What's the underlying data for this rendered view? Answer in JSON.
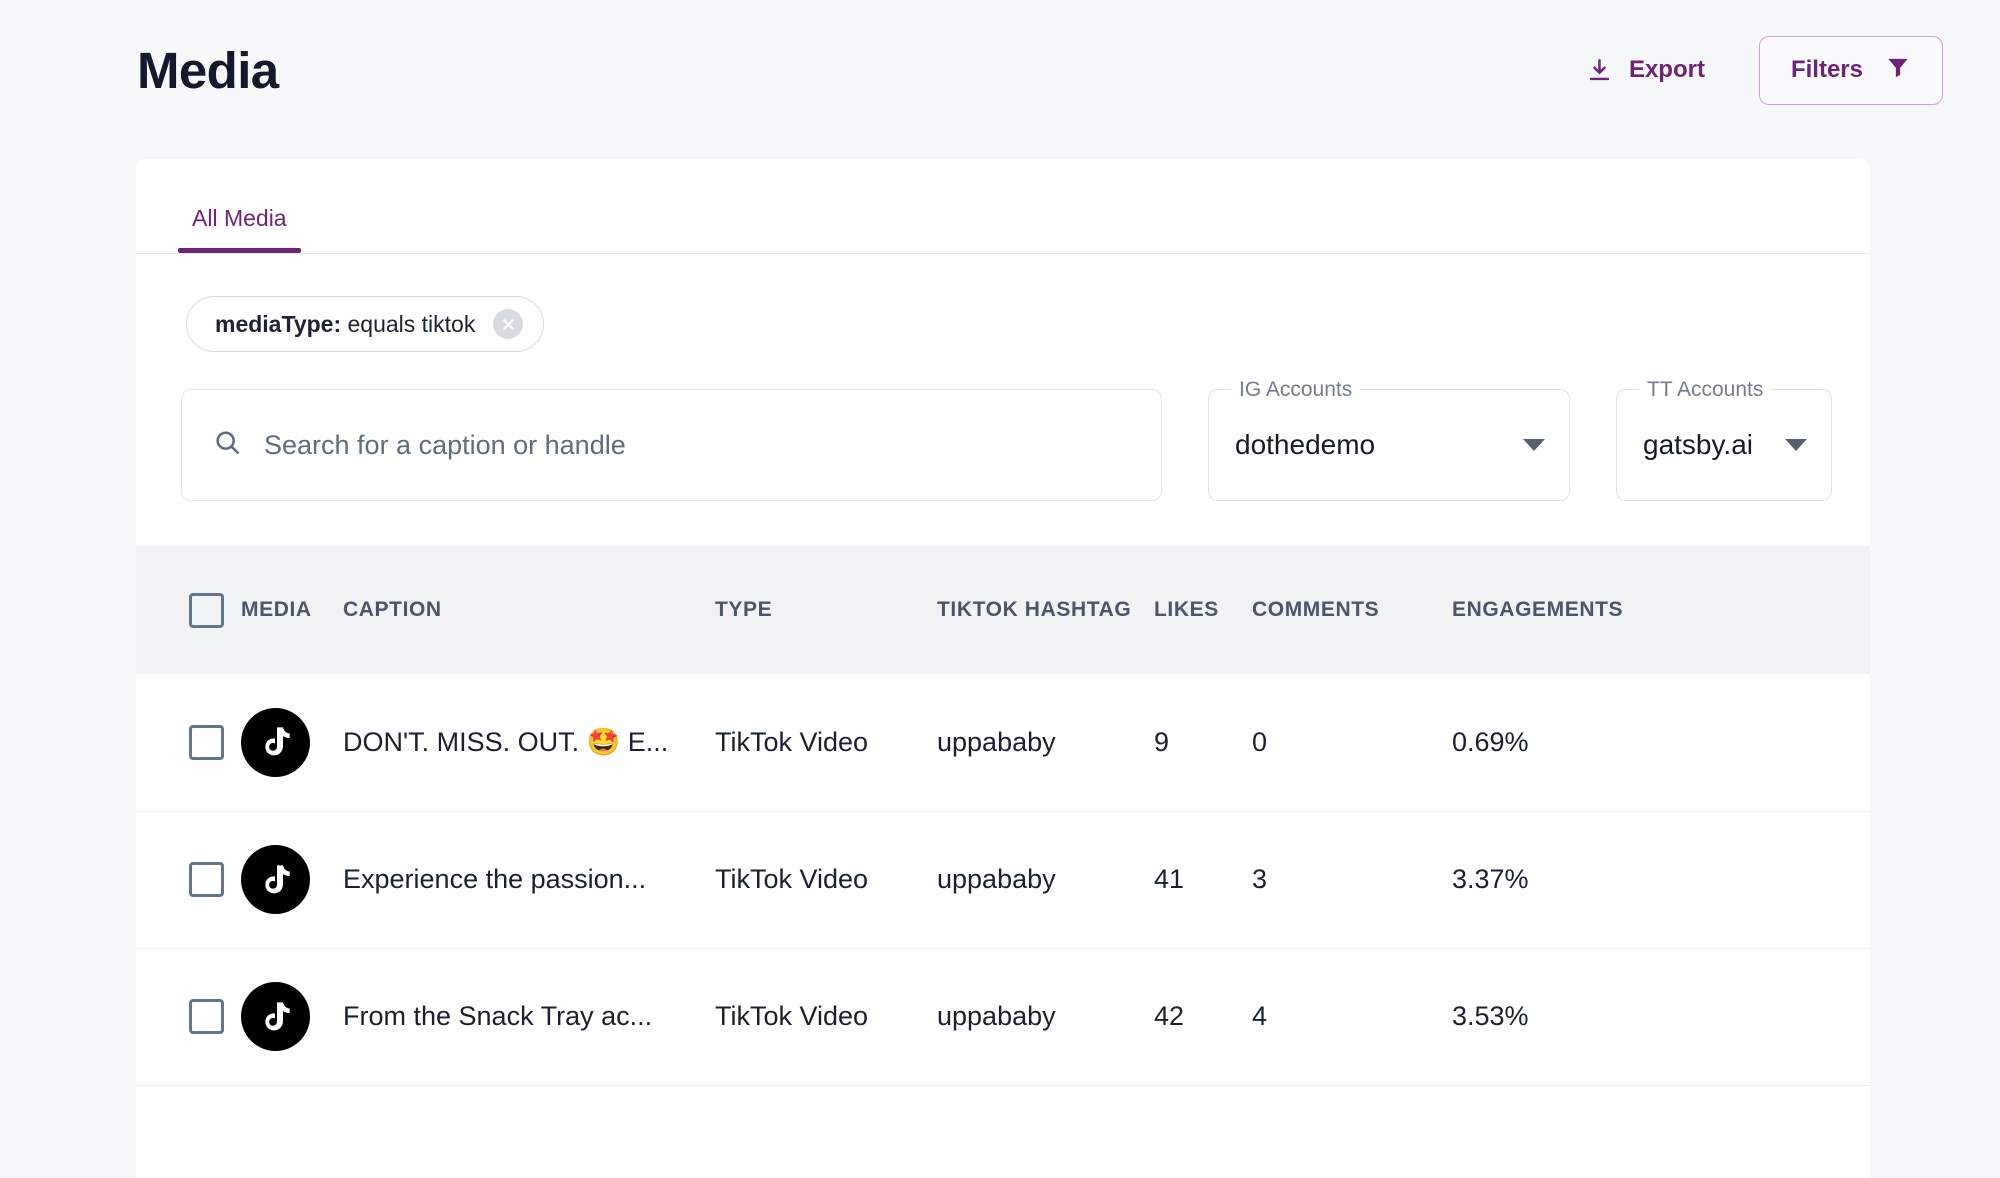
{
  "header": {
    "title": "Media",
    "export_label": "Export",
    "export_icon": "download-icon",
    "filters_label": "Filters",
    "filters_icon": "funnel-icon",
    "accent_color": "#6e2376"
  },
  "tabs": [
    {
      "label": "All Media",
      "active": true
    }
  ],
  "filter_chips": [
    {
      "key": "mediaType:",
      "value": "equals tiktok",
      "close_icon": "close-circle-icon"
    }
  ],
  "search": {
    "placeholder": "Search for a caption or handle",
    "value": "",
    "icon": "search-icon"
  },
  "selects": [
    {
      "label": "IG Accounts",
      "value": "dothedemo",
      "icon": "chevron-down-icon"
    },
    {
      "label": "TT Accounts",
      "value": "gatsby.ai",
      "icon": "chevron-down-icon"
    }
  ],
  "table": {
    "select_all_checked": false,
    "columns": [
      "MEDIA",
      "CAPTION",
      "TYPE",
      "TIKTOK HASHTAG",
      "LIKES",
      "COMMENTS",
      "ENGAGEMENTS"
    ],
    "rows": [
      {
        "checked": false,
        "avatar_icon": "tiktok-logo-icon",
        "caption": "DON'T. MISS. OUT. 🤩 E...",
        "type": "TikTok Video",
        "hashtag": "uppababy",
        "likes": "9",
        "comments": "0",
        "engagements": "0.69%"
      },
      {
        "checked": false,
        "avatar_icon": "tiktok-logo-icon",
        "caption": "Experience the passion...",
        "type": "TikTok Video",
        "hashtag": "uppababy",
        "likes": "41",
        "comments": "3",
        "engagements": "3.37%"
      },
      {
        "checked": false,
        "avatar_icon": "tiktok-logo-icon",
        "caption": "From the Snack Tray ac...",
        "type": "TikTok Video",
        "hashtag": "uppababy",
        "likes": "42",
        "comments": "4",
        "engagements": "3.53%"
      }
    ]
  }
}
